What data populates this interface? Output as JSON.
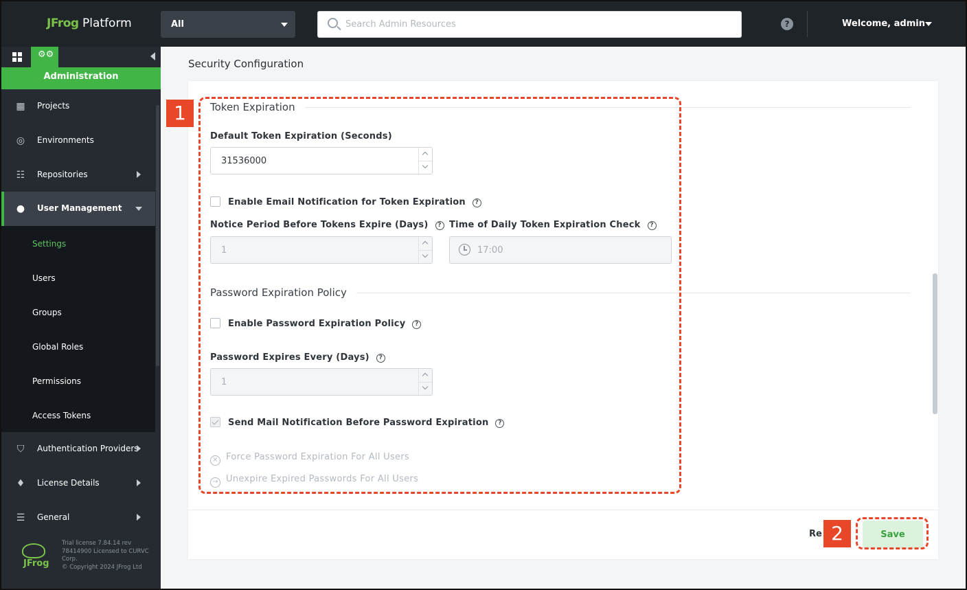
{
  "topbar": {
    "logo_brand": "JFrog",
    "logo_product": "Platform",
    "scope_value": "All",
    "search_placeholder": "Search Admin Resources",
    "help_glyph": "?",
    "welcome": "Welcome, admin"
  },
  "sidebar": {
    "section": "Administration",
    "items": [
      {
        "label": "Projects",
        "icon": "projects-icon"
      },
      {
        "label": "Environments",
        "icon": "environments-icon"
      },
      {
        "label": "Repositories",
        "icon": "repositories-icon"
      },
      {
        "label": "User Management",
        "icon": "user-icon"
      },
      {
        "label": "Authentication Providers",
        "icon": "shield-icon"
      },
      {
        "label": "License Details",
        "icon": "award-icon"
      },
      {
        "label": "General",
        "icon": "sliders-icon"
      }
    ],
    "sub_items": [
      "Settings",
      "Users",
      "Groups",
      "Global Roles",
      "Permissions",
      "Access Tokens"
    ],
    "footer_logo": "JFrog",
    "footer_lines": [
      "Trial license 7.84.14 rev",
      "78414900 Licensed to CURVC",
      "Corp.",
      "© Copyright 2024 JFrog Ltd"
    ]
  },
  "main": {
    "page_title": "Security Configuration",
    "token_section": "Token Expiration",
    "default_token_label": "Default Token Expiration (Seconds)",
    "default_token_value": "31536000",
    "email_notify_label": "Enable Email Notification for Token Expiration",
    "notice_period_label": "Notice Period Before Tokens Expire (Days)",
    "notice_period_value": "1",
    "daily_check_label": "Time of Daily Token Expiration Check",
    "daily_check_value": "17:00",
    "password_section": "Password Expiration Policy",
    "enable_password_label": "Enable Password Expiration Policy",
    "password_days_label": "Password Expires Every (Days)",
    "password_days_value": "1",
    "send_mail_label": "Send Mail Notification Before Password Expiration",
    "force_expire_label": "Force Password Expiration For All Users",
    "unexpire_label": "Unexpire Expired Passwords For All Users",
    "reset_label": "Re",
    "save_label": "Save"
  },
  "annotations": {
    "badge_1": "1",
    "badge_2": "2",
    "color": "#e8472a"
  },
  "colors": {
    "accent_green": "#42b547",
    "topbar_bg": "#1f2429",
    "sidebar_bg": "#252b31"
  }
}
